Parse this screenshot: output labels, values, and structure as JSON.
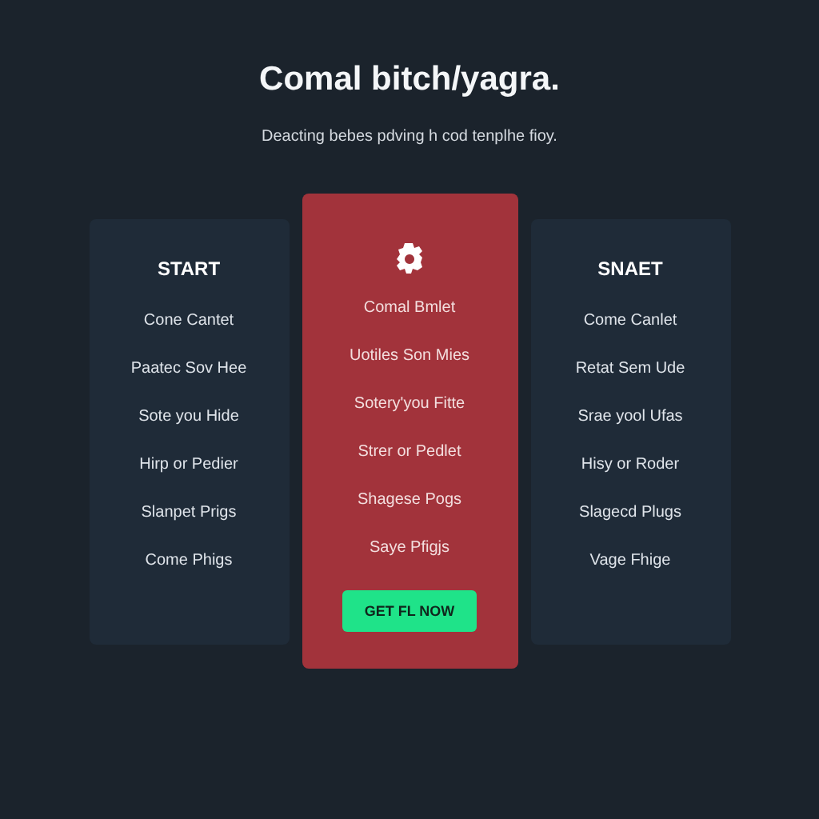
{
  "header": {
    "title": "Comal bitch/yagra.",
    "subtitle": "Deacting bebes pdving h cod tenplhe fioy."
  },
  "plans": [
    {
      "kind": "basic",
      "name": "START",
      "features": [
        "Cone Cantet",
        "Paatec Sov Hee",
        "Sote you Hide",
        "Hirp or Pedier",
        "Slanpet Prigs",
        "Come Phigs"
      ]
    },
    {
      "kind": "featured",
      "features": [
        "Comal Bmlet",
        "Uotiles Son Mies",
        "Sotery'you Fitte",
        "Strer or Pedlet",
        "Shagese Pogs",
        "Saye Pfigjs"
      ],
      "button": "GET FL NOW"
    },
    {
      "kind": "basic",
      "name": "SNAET",
      "features": [
        "Come Canlet",
        "Retat Sem Ude",
        "Srae yool Ufas",
        "Hisy or Roder",
        "Slagecd Plugs",
        "Vage Fhige"
      ]
    }
  ]
}
